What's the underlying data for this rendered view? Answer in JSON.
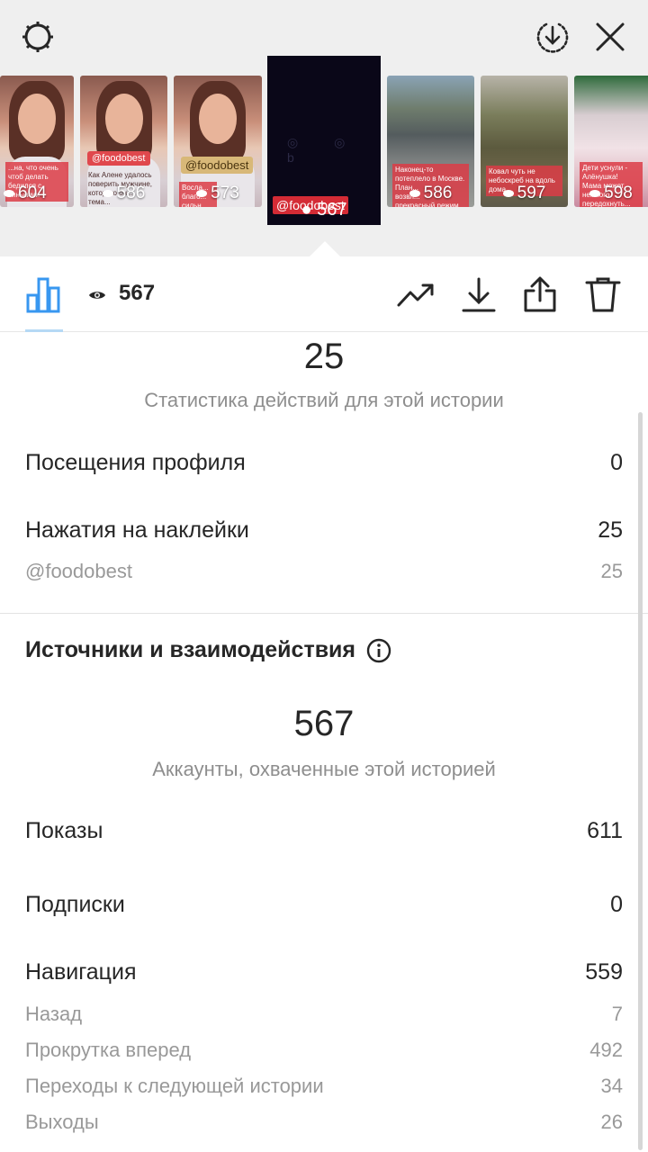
{
  "story_strip": [
    {
      "views": "604",
      "tag": ""
    },
    {
      "views": "586",
      "tag": "@foodobest"
    },
    {
      "views": "573",
      "tag": "@foodobest"
    },
    {
      "views": "567",
      "tag": "@foodobest"
    },
    {
      "views": "586",
      "tag": ""
    },
    {
      "views": "597",
      "tag": ""
    },
    {
      "views": "598",
      "tag": ""
    }
  ],
  "thumb_captions": {
    "c1": "...на, что очень\nчтоб делать\nбедился с\nсинькими",
    "c2": "Как Алене удалось\nповерить мужчине,\nкоторого он...\nтема...\nкомпь...\nза ним в незнакомую",
    "c3": "Восла...\nблаго...\nсильн...\nоснове...",
    "c5": "Наконец-то\nпотеплело в Москве.\nПлан...\nвозвл...\nпрекрасный режим.",
    "c6": "Ковал чуть не\nнебоскреб на вдоль\nдома...",
    "c7": "Дети уснули -\nАлёнушка!\nМама может немного\nпередохнуть..."
  },
  "current_story": {
    "tag": "@foodobest",
    "views": "567",
    "glyphs": "◎ ◎ b"
  },
  "toolbar": {
    "viewer_count": "567"
  },
  "interactions": {
    "total": "25",
    "subtitle": "Статистика действий для этой истории",
    "rows": [
      {
        "label": "Посещения профиля",
        "value": "0"
      },
      {
        "label": "Нажатия на наклейки",
        "value": "25"
      }
    ],
    "sub_rows": [
      {
        "label": "@foodobest",
        "value": "25"
      }
    ]
  },
  "discovery": {
    "title": "Источники и взаимодействия",
    "reach": "567",
    "reach_subtitle": "Аккаунты, охваченные этой историей",
    "rows": [
      {
        "label": "Показы",
        "value": "611"
      },
      {
        "label": "Подписки",
        "value": "0"
      },
      {
        "label": "Навигация",
        "value": "559"
      }
    ],
    "navigation_rows": [
      {
        "label": "Назад",
        "value": "7"
      },
      {
        "label": "Прокрутка вперед",
        "value": "492"
      },
      {
        "label": "Переходы к следующей истории",
        "value": "34"
      },
      {
        "label": "Выходы",
        "value": "26"
      }
    ]
  },
  "colors": {
    "accent": "#3897f0",
    "text": "#262626",
    "muted": "#8e8e8e",
    "tag_red": "#e0484d"
  },
  "icons": [
    "gear-icon",
    "download-circle-icon",
    "close-icon",
    "bar-chart-icon",
    "eye-icon",
    "trending-up-icon",
    "download-icon",
    "share-icon",
    "trash-icon",
    "info-icon"
  ]
}
